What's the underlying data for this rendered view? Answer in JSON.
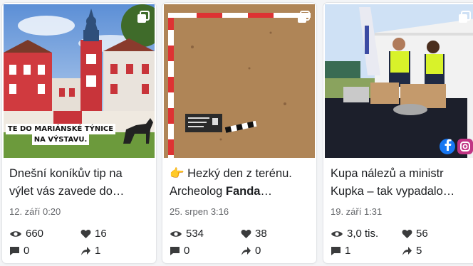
{
  "cards": [
    {
      "overlay_line1": "TE DO MARIÁNSKÉ TÝNICE",
      "overlay_line2": "NA VÝSTAVU.",
      "title": "Dnešní koníkův tip na\nvýlet vás zavede do…",
      "date": "12. září 0:20",
      "views": "660",
      "likes": "16",
      "comments": "0",
      "shares": "1"
    },
    {
      "title_emoji": "👉",
      "title_line1": " Hezký den z terénu.",
      "title_line2_prefix": "Archeolog ",
      "title_line2_bold": "Fanda",
      "title_line2_suffix": "…",
      "date": "25. srpen 3:16",
      "views": "534",
      "likes": "38",
      "comments": "0",
      "shares": "0"
    },
    {
      "title": "Kupa nálezů a ministr\nKupka – tak vypadalo…",
      "date": "19. září 1:31",
      "views": "3,0 tis.",
      "likes": "56",
      "comments": "1",
      "shares": "5"
    }
  ],
  "icons": {
    "views": "eye-icon",
    "likes": "heart-icon",
    "comments": "comment-icon",
    "shares": "share-arrow-icon",
    "multi": "multiple-photos-icon"
  }
}
